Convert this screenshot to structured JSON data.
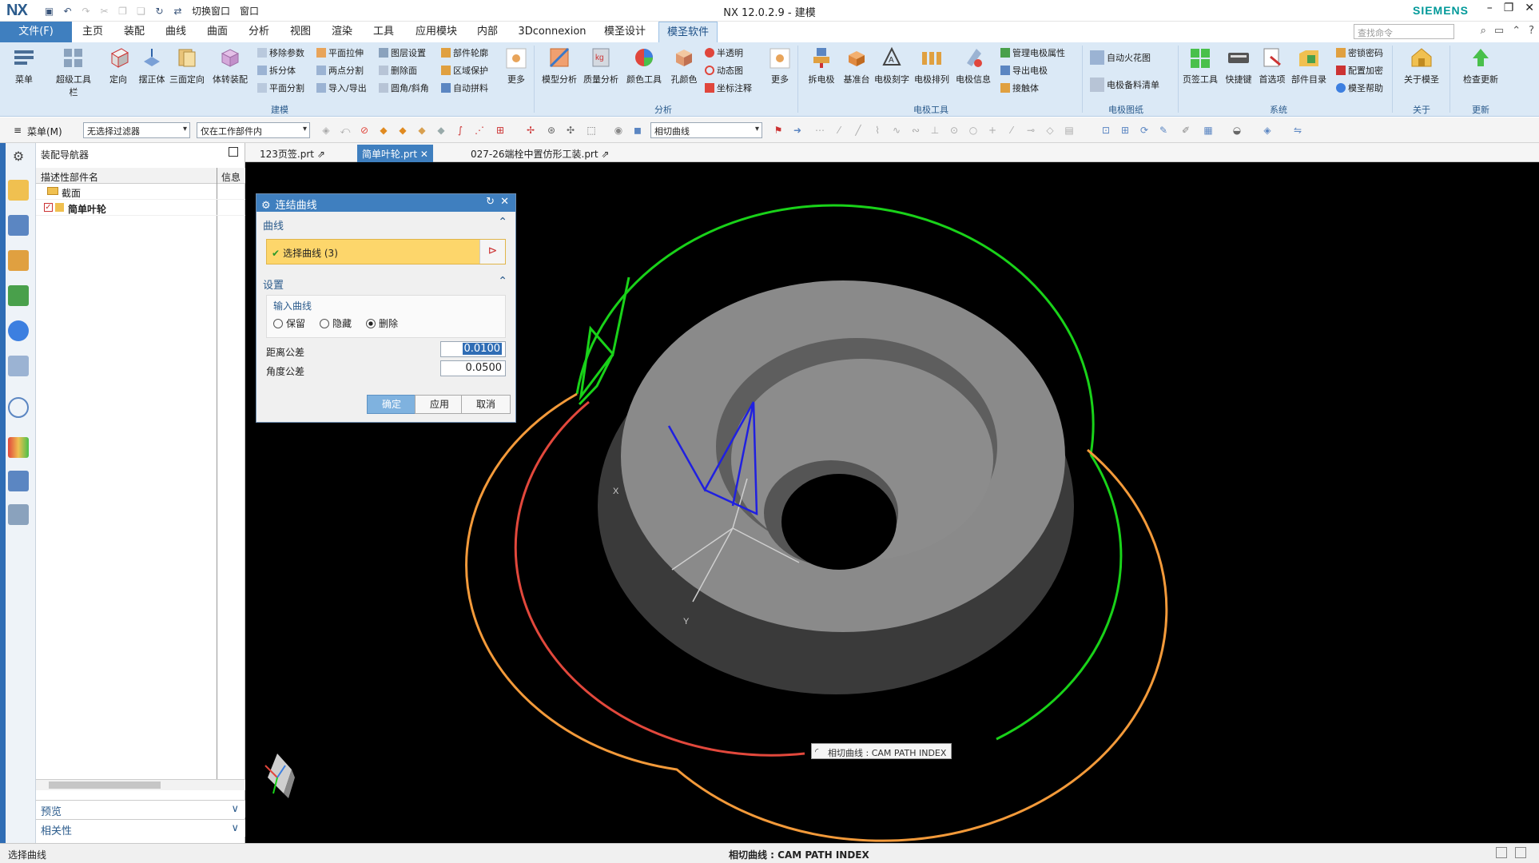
{
  "app": {
    "logo": "NX",
    "window_title": "NX 12.0.2.9 - 建模",
    "brand": "SIEMENS",
    "qat_switch_window": "切换窗口",
    "qat_window": "窗口"
  },
  "menubar": {
    "items": [
      "文件(F)",
      "主页",
      "装配",
      "曲线",
      "曲面",
      "分析",
      "视图",
      "渲染",
      "工具",
      "应用模块",
      "内部",
      "3Dconnexion",
      "模圣设计",
      "模圣软件"
    ],
    "search_placeholder": "查找命令"
  },
  "ribbon": {
    "big": [
      "菜单",
      "超级工具栏",
      "定向",
      "摆正体",
      "三面定向",
      "体转装配",
      "更多",
      "模型分析",
      "质量分析",
      "颜色工具",
      "孔颜色",
      "更多",
      "拆电极",
      "基准台",
      "电极刻字",
      "电极排列",
      "电极信息",
      "页签工具",
      "快捷键",
      "首选项",
      "部件目录",
      "关于模圣",
      "检查更新"
    ],
    "small": [
      "移除参数",
      "平面拉伸",
      "图层设置",
      "部件轮廓",
      "拆分体",
      "两点分割",
      "删除面",
      "区域保护",
      "平面分割",
      "导入/导出",
      "圆角/斜角",
      "自动拼料",
      "半透明",
      "动态图",
      "坐标注释",
      "管理电极属性",
      "导出电极",
      "接触体",
      "自动火花图",
      "电极备料清单",
      "密锁密码",
      "配置加密",
      "模圣帮助"
    ],
    "groups": [
      "建模",
      "分析",
      "电极工具",
      "电极图纸",
      "系统",
      "关于",
      "更新"
    ]
  },
  "toolbar2": {
    "menu": "菜单(M)",
    "filter": "无选择过滤器",
    "scope": "仅在工作部件内",
    "curve_rule": "相切曲线"
  },
  "navigator": {
    "title": "装配导航器",
    "col_name": "描述性部件名",
    "col_info": "信息",
    "rows": [
      "截面",
      "简单叶轮"
    ],
    "preview": "预览",
    "relevance": "相关性"
  },
  "tabs": [
    "123页签.prt",
    "简单叶轮.prt",
    "027-26端栓中置仿形工装.prt"
  ],
  "dialog": {
    "title": "连结曲线",
    "sec_curve": "曲线",
    "select_curve": "选择曲线 (3)",
    "sec_settings": "设置",
    "input_curve": "输入曲线",
    "opt_keep": "保留",
    "opt_hide": "隐藏",
    "opt_delete": "删除",
    "dist_tol_label": "距离公差",
    "dist_tol_value": "0.0100",
    "angle_tol_label": "角度公差",
    "angle_tol_value": "0.0500",
    "ok": "确定",
    "apply": "应用",
    "cancel": "取消"
  },
  "viewport": {
    "tooltip": "相切曲线 : CAM PATH INDEX",
    "axis_x": "X",
    "axis_y": "Y"
  },
  "status": {
    "left": "选择曲线",
    "center": "相切曲线 : CAM PATH INDEX"
  },
  "colors": {
    "accent": "#3f7fbf",
    "ribbon_bg": "#dbe9f6",
    "highlight": "#fdd66b",
    "curve_green": "#19d219",
    "curve_orange": "#f39a3a",
    "curve_red": "#e2483c"
  }
}
